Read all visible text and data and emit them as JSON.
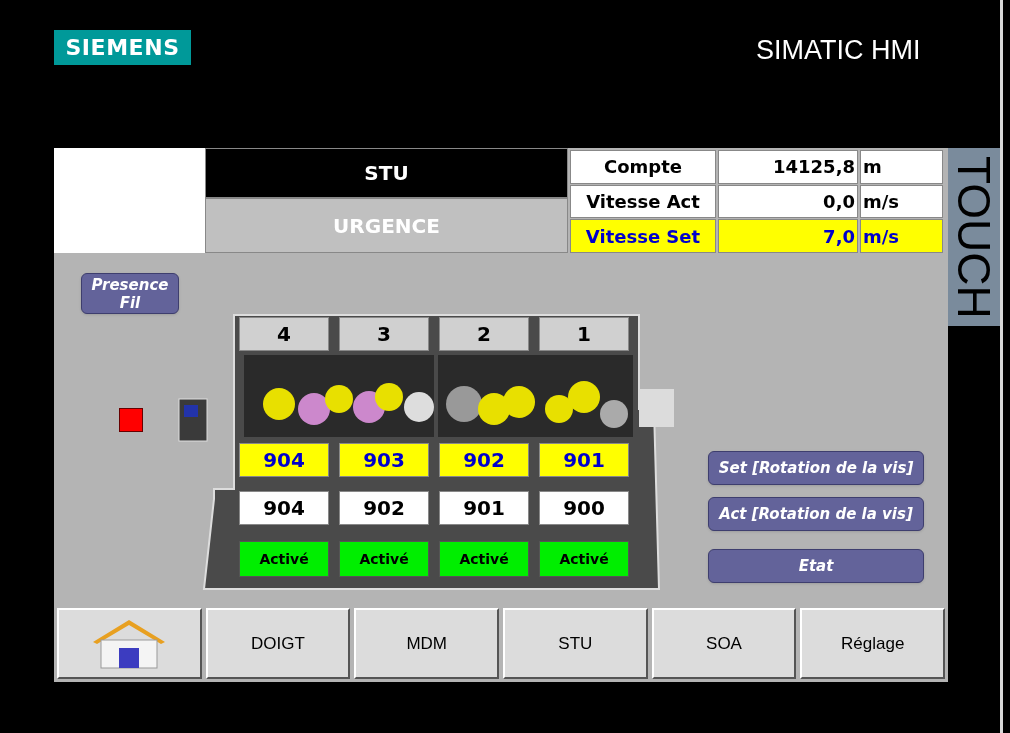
{
  "brand": {
    "logo": "SIEMENS",
    "product": "SIMATIC HMI",
    "bezel_label": "TOUCH"
  },
  "header": {
    "title": "STU",
    "alarm": "URGENCE"
  },
  "readouts": [
    {
      "label": "Compte",
      "value": "14125,8",
      "unit": "m",
      "highlighted": false
    },
    {
      "label": "Vitesse Act",
      "value": "0,0",
      "unit": "m/s",
      "highlighted": false
    },
    {
      "label": "Vitesse Set",
      "value": "7,0",
      "unit": "m/s",
      "highlighted": true
    }
  ],
  "presence_button": "Presence Fil",
  "wire_present": false,
  "stations": [
    {
      "number": "4",
      "set": "904",
      "act": "904",
      "status": "Activé",
      "active": true
    },
    {
      "number": "3",
      "set": "903",
      "act": "902",
      "status": "Activé",
      "active": true
    },
    {
      "number": "2",
      "set": "902",
      "act": "901",
      "status": "Activé",
      "active": true
    },
    {
      "number": "1",
      "set": "901",
      "act": "900",
      "status": "Activé",
      "active": true
    }
  ],
  "side_buttons": [
    "Set [Rotation de la vis]",
    "Act [Rotation de la vis]",
    "Etat"
  ],
  "nav": [
    {
      "kind": "home"
    },
    {
      "kind": "text",
      "label": "DOIGT"
    },
    {
      "kind": "text",
      "label": "MDM"
    },
    {
      "kind": "text",
      "label": "STU"
    },
    {
      "kind": "text",
      "label": "SOA"
    },
    {
      "kind": "text",
      "label": "Réglage"
    }
  ]
}
